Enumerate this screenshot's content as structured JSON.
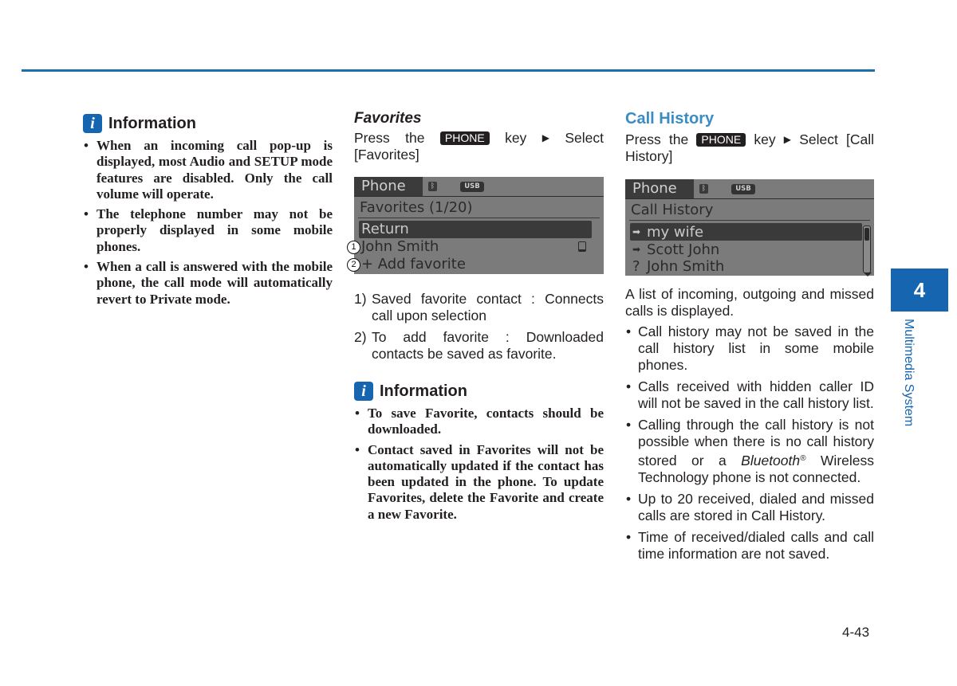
{
  "header_rule_color": "#1f6fa8",
  "column1": {
    "info": {
      "icon": "info-icon",
      "title": "Information",
      "bullets": [
        "When an incoming call pop-up is displayed, most Audio and SETUP mode features are disabled. Only the call volume will operate.",
        "The telephone number may not be properly displayed in some mobile phones.",
        "When a call is answered with the mobile phone, the call mode will automatically revert to Private mode."
      ]
    }
  },
  "column2": {
    "title": "Favorites",
    "instruction": {
      "pre": "Press the",
      "key": "PHONE",
      "mid": "key",
      "arrow": "▶",
      "post": "Select [Favorites]"
    },
    "screen": {
      "tab": "Phone",
      "bt_icon": "bluetooth-icon",
      "usb": "USB",
      "subtitle": "Favorites (1/20)",
      "rows": [
        {
          "label": "Return",
          "selected": true
        },
        {
          "label": "John Smith",
          "callout": "1",
          "icon": "phone-icon"
        },
        {
          "label": "+ Add favorite",
          "callout": "2"
        }
      ]
    },
    "notes": [
      {
        "num": "1)",
        "text": "Saved favorite contact : Connects call upon selection"
      },
      {
        "num": "2)",
        "text": "To add favorite : Downloaded contacts be saved as favorite."
      }
    ],
    "info": {
      "icon": "info-icon",
      "title": "Information",
      "bullets": [
        "To save Favorite, contacts should be downloaded.",
        "Contact saved in Favorites will not be automatically updated if the contact has been updated in the phone. To update Favorites, delete the Favorite and create a new Favorite."
      ]
    }
  },
  "column3": {
    "title": "Call History",
    "instruction": {
      "pre": "Press the",
      "key": "PHONE",
      "mid": "key",
      "arrow": "▶",
      "post": "Select [Call History]"
    },
    "screen": {
      "tab": "Phone",
      "bt_icon": "bluetooth-icon",
      "usb": "USB",
      "subtitle": "Call History",
      "rows": [
        {
          "glyph": "➡",
          "label": "my wife",
          "selected": true
        },
        {
          "glyph": "➡",
          "label": "Scott John"
        },
        {
          "glyph": "?",
          "label": "John Smith"
        }
      ]
    },
    "intro": "A list of incoming, outgoing and missed calls is displayed.",
    "bullets": [
      "Call history may not be saved in the call history list in some mobile phones.",
      "Calls received with hidden caller ID will not be saved in the call history list.",
      {
        "pre": "Calling through the call history is not possible when there is no call history stored or a ",
        "italic": "Bluetooth",
        "sup": "®",
        "post": " Wireless Technology phone is not connected."
      },
      "Up to 20 received, dialed and missed calls are stored in Call History.",
      "Time of received/dialed calls and call time information are not saved."
    ]
  },
  "chapter": {
    "number": "4",
    "title": "Multimedia System",
    "color": "#1565b0"
  },
  "page_number": "4-43"
}
